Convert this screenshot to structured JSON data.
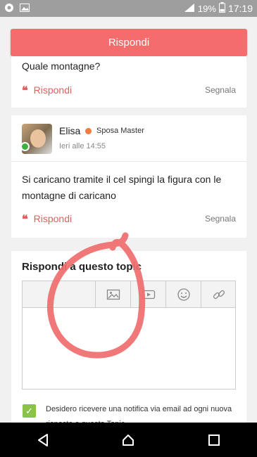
{
  "status_bar": {
    "battery": "19%",
    "time": "17:19",
    "network": "4G"
  },
  "header": {
    "reply_button": "Rispondi"
  },
  "previous_post": {
    "cut_text": "Quale montagne?",
    "reply_label": "Rispondi",
    "report_label": "Segnala"
  },
  "post": {
    "author": "Elisa",
    "role": "Sposa Master",
    "timestamp": "Ieri alle 14:55",
    "text": "Si caricano tramite il cel spingi la figura con le montagne di caricano",
    "reply_label": "Rispondi",
    "report_label": "Segnala"
  },
  "reply_form": {
    "title": "Rispondi a questo topic",
    "toolbar": [
      "image-icon",
      "video-icon",
      "emoji-icon",
      "link-icon"
    ],
    "notify_checked": true,
    "notify_text": "Desidero ricevere una notifica via email ad ogni nuova risposta a questo Topic"
  },
  "colors": {
    "accent": "#f46c6c",
    "link": "#e15f5f",
    "online": "#3db13d",
    "badge": "#f07b3f",
    "check": "#8bc34a"
  }
}
